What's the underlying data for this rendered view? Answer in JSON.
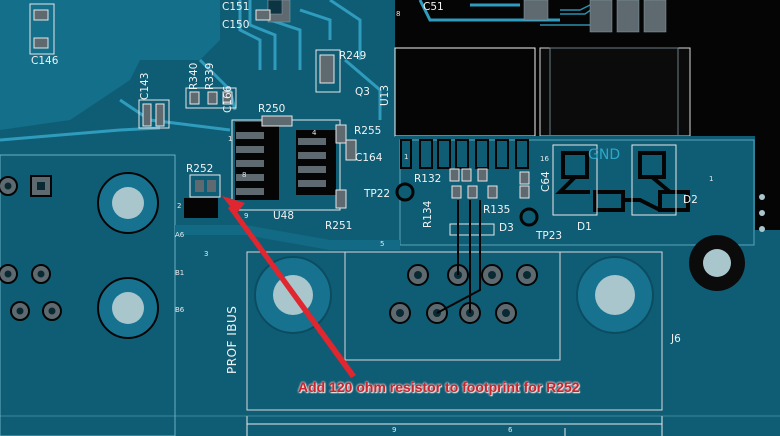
{
  "colors": {
    "board": "#0f5f78",
    "copper": "#1a7f9c",
    "trace": "#2a97b8",
    "pad": "#5f6a70",
    "pad_hole": "#0a2a33",
    "silk": "#ffffff",
    "annotation": "#c9242b",
    "arrow": "#e0262e"
  },
  "labels": {
    "C151": "C151",
    "C150": "C150",
    "C51": "C51",
    "C146": "C146",
    "C143": "C143",
    "R340": "R340",
    "R339": "R339",
    "C166": "C166",
    "R249": "R249",
    "Q3": "Q3",
    "U13": "U13",
    "R250": "R250",
    "R255": "R255",
    "C164": "C164",
    "R252": "R252",
    "U48": "U48",
    "R251": "R251",
    "TP22": "TP22",
    "R132": "R132",
    "R134": "R134",
    "R135": "R135",
    "D3": "D3",
    "C64": "C64",
    "TP23": "TP23",
    "D1": "D1",
    "D2": "D2",
    "J6": "J6",
    "A6": "A6",
    "B1": "B1",
    "B6": "B6",
    "profibus": "PROF IBUS",
    "gnd_faded": "GND",
    "dim_9": "9",
    "dim_6": "6",
    "pin_1a": "1",
    "pin_2": "2",
    "pin_3": "3",
    "pin_4": "4",
    "pin_5": "5",
    "pin_8a": "8",
    "pin_8b": "8",
    "pin_9": "9",
    "pin_16": "16",
    "pin_1b": "1",
    "pin_1c": "1"
  },
  "annotation": "Add 120 ohm resistor to footprint for R252"
}
